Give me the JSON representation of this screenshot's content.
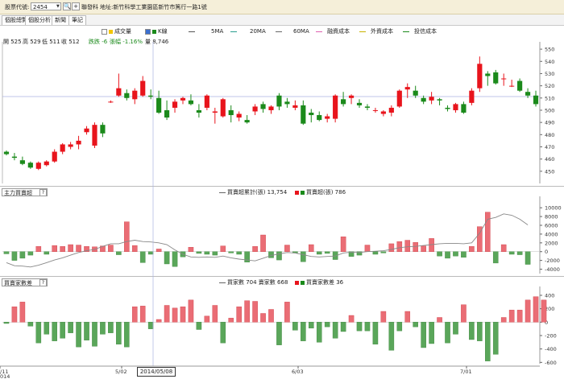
{
  "toolbar": {
    "symbol_label": "股票代號:",
    "symbol_value": "2454",
    "search_glyph": "🔍",
    "add_glyph": "+",
    "company_name": "聯發科",
    "address": "地址:新竹科學工業園區新竹市篤行一路1號"
  },
  "tabs": [
    "個股總覽",
    "個股分析",
    "新聞",
    "筆記"
  ],
  "price_legend": {
    "volume": "成交量",
    "kline": "K線",
    "ma5": "5MA",
    "ma20": "20MA",
    "ma60": "60MA",
    "margin_cost": "融資成本",
    "foreign_cost": "外資成本",
    "trust_cost": "投信成本"
  },
  "ohlc_info": {
    "open": "開 525",
    "high": "高 529",
    "low": "低 511",
    "close": "收 512",
    "change": "跌跌 -6",
    "change_pct": "張幅 -1.16%",
    "volume": "量 8,746"
  },
  "panel2": {
    "select": "主力買賣超",
    "help": "?",
    "legend_line": "買賣超累計(張) 13,754",
    "legend_bar": "買賣超(張) 786"
  },
  "panel3": {
    "select": "買賣家數差",
    "help": "?",
    "legend_line": "買家數 704 賣家數 668",
    "legend_bar": "買賣家數差 36"
  },
  "x_labels": [
    "/11",
    "5/02",
    "6/03",
    "7/01"
  ],
  "x_extra": "014",
  "crosshair_date": "2014/05/08",
  "colors": {
    "up": "#e8141c",
    "down": "#1b8a1b",
    "bar_up": "#ea6d75",
    "bar_down": "#5aa65a"
  },
  "chart_data": [
    {
      "type": "candlestick",
      "title": "",
      "ylim": [
        440,
        556
      ],
      "yticks": [
        450,
        460,
        470,
        480,
        490,
        500,
        510,
        520,
        530,
        540,
        550
      ],
      "candles": [
        [
          466,
          467,
          463,
          464
        ],
        [
          462,
          465,
          459,
          461
        ],
        [
          459,
          462,
          455,
          456
        ],
        [
          457,
          458,
          452,
          453
        ],
        [
          452,
          458,
          451,
          457
        ],
        [
          455,
          459,
          454,
          458
        ],
        [
          458,
          468,
          457,
          466
        ],
        [
          466,
          473,
          464,
          472
        ],
        [
          470,
          474,
          468,
          472
        ],
        [
          472,
          479,
          468,
          475
        ],
        [
          482,
          487,
          480,
          485
        ],
        [
          471,
          490,
          469,
          488
        ],
        [
          488,
          490,
          478,
          481
        ],
        [
          507,
          508,
          506,
          507
        ],
        [
          512,
          530,
          511,
          518
        ],
        [
          514,
          517,
          508,
          510
        ],
        [
          509,
          518,
          505,
          516
        ],
        [
          512,
          528,
          511,
          524
        ],
        [
          512,
          517,
          509,
          511
        ],
        [
          510,
          516,
          497,
          498
        ],
        [
          500,
          508,
          492,
          494
        ],
        [
          502,
          509,
          498,
          507
        ],
        [
          508,
          511,
          505,
          510
        ],
        [
          508,
          513,
          504,
          505
        ],
        [
          500,
          505,
          494,
          498
        ],
        [
          502,
          513,
          500,
          512
        ],
        [
          498,
          502,
          489,
          499
        ],
        [
          495,
          510,
          494,
          509
        ],
        [
          500,
          504,
          490,
          496
        ],
        [
          494,
          499,
          491,
          497
        ],
        [
          492,
          496,
          489,
          490
        ],
        [
          499,
          505,
          496,
          503
        ],
        [
          505,
          507,
          498,
          501
        ],
        [
          500,
          504,
          497,
          503
        ],
        [
          512,
          514,
          500,
          503
        ],
        [
          507,
          510,
          502,
          505
        ],
        [
          502,
          508,
          500,
          504
        ],
        [
          504,
          508,
          488,
          489
        ],
        [
          498,
          501,
          490,
          496
        ],
        [
          496,
          499,
          491,
          492
        ],
        [
          493,
          497,
          490,
          495
        ],
        [
          493,
          513,
          490,
          512
        ],
        [
          509,
          515,
          503,
          505
        ],
        [
          510,
          513,
          505,
          512
        ],
        [
          506,
          509,
          502,
          504
        ],
        [
          503,
          505,
          500,
          502
        ],
        [
          500,
          502,
          498,
          500
        ],
        [
          497,
          500,
          495,
          499
        ],
        [
          498,
          504,
          495,
          502
        ],
        [
          503,
          517,
          502,
          516
        ],
        [
          517,
          522,
          510,
          519
        ],
        [
          516,
          520,
          510,
          512
        ],
        [
          510,
          512,
          505,
          507
        ],
        [
          508,
          515,
          505,
          511
        ],
        [
          509,
          510,
          504,
          508
        ],
        [
          502,
          504,
          499,
          501
        ],
        [
          500,
          506,
          498,
          505
        ],
        [
          505,
          507,
          497,
          498
        ],
        [
          506,
          518,
          504,
          516
        ],
        [
          518,
          544,
          515,
          538
        ],
        [
          530,
          532,
          520,
          528
        ],
        [
          531,
          533,
          521,
          522
        ],
        [
          526,
          530,
          520,
          526
        ],
        [
          520,
          525,
          519,
          520
        ],
        [
          524,
          526,
          515,
          516
        ],
        [
          515,
          518,
          510,
          512
        ],
        [
          512,
          516,
          503,
          505
        ]
      ]
    },
    {
      "type": "bar",
      "title": "",
      "ylim": [
        -5000,
        11500
      ],
      "yticks": [
        -4000,
        -2000,
        0,
        2000,
        4000,
        6000,
        8000,
        10000
      ],
      "bar_series": "買賣超(張)",
      "line_series": "買賣超累計(張)",
      "values": [
        -500,
        -2000,
        -1500,
        -800,
        1200,
        -600,
        1400,
        1200,
        1600,
        1500,
        1200,
        1100,
        1300,
        1500,
        -700,
        6800,
        1400,
        -2500,
        -600,
        600,
        -2800,
        -3400,
        -1200,
        1000,
        -400,
        -600,
        -800,
        1300,
        -300,
        -600,
        -2400,
        1200,
        3800,
        -1400,
        -1900,
        1500,
        -300,
        -2300,
        1600,
        -600,
        -400,
        -1800,
        3400,
        -1100,
        -800,
        1500,
        -600,
        -300,
        1800,
        2300,
        2600,
        2100,
        1300,
        3000,
        -1000,
        -1500,
        -1000,
        -1300,
        1200,
        5700,
        9000,
        -2600,
        1600,
        -600,
        -700,
        -2900
      ],
      "line": [
        -2500,
        -3200,
        -3300,
        -3500,
        -3100,
        -2500,
        -1900,
        -1400,
        -800,
        -200,
        200,
        500,
        1200,
        1800,
        1800,
        2300,
        2600,
        2300,
        2200,
        2000,
        1600,
        400,
        -600,
        -1200,
        -1300,
        -1200,
        -1300,
        -1000,
        -1400,
        -1700,
        -1900,
        -2100,
        -1500,
        -900,
        -500,
        -200,
        -300,
        -700,
        -1100,
        -1200,
        -1100,
        -1000,
        -300,
        -100,
        -200,
        0,
        100,
        200,
        500,
        900,
        1100,
        1200,
        1400,
        1600,
        1800,
        1900,
        1900,
        1800,
        2000,
        4200,
        7400,
        7800,
        8600,
        8300,
        7400,
        6100
      ]
    },
    {
      "type": "bar",
      "title": "",
      "ylim": [
        -620,
        460
      ],
      "yticks": [
        -600,
        -400,
        -200,
        0,
        200,
        400
      ],
      "bar_series": "買賣家數差",
      "values": [
        -20,
        230,
        300,
        -60,
        -310,
        -180,
        -280,
        -240,
        -160,
        -370,
        -270,
        -360,
        -180,
        -160,
        -330,
        -370,
        230,
        240,
        -100,
        40,
        250,
        210,
        230,
        330,
        -110,
        90,
        250,
        -310,
        60,
        230,
        320,
        310,
        130,
        190,
        -340,
        300,
        -120,
        -280,
        -90,
        -300,
        -70,
        -240,
        -140,
        100,
        -130,
        -130,
        -330,
        160,
        -420,
        -130,
        160,
        -70,
        -380,
        -320,
        70,
        -310,
        -180,
        260,
        -260,
        -280,
        -580,
        -480,
        70,
        180,
        180,
        330,
        380,
        330
      ]
    }
  ]
}
